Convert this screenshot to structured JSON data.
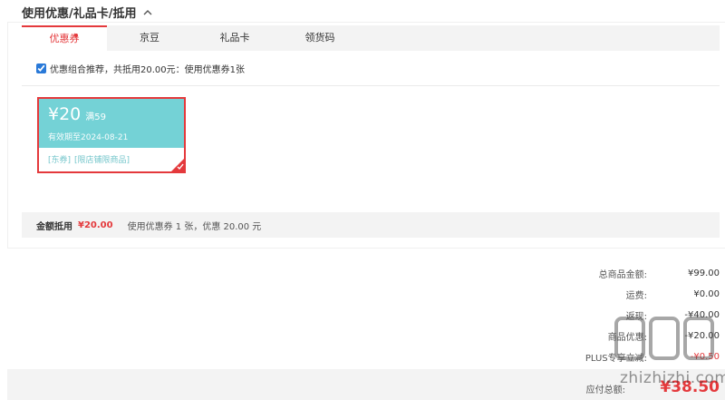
{
  "section": {
    "title": "使用优惠/礼品卡/抵用"
  },
  "tabs": [
    {
      "label": "优惠券"
    },
    {
      "label": "京豆"
    },
    {
      "label": "礼品卡"
    },
    {
      "label": "领货码"
    }
  ],
  "combo": {
    "label": "优惠组合推荐，共抵用20.00元：使用优惠券1张",
    "checked": true
  },
  "coupon": {
    "amount": "¥20",
    "condition": "满59",
    "validity": "有效期至2024-08-21",
    "tags": [
      "[东券]",
      "[限店铺限商品]"
    ]
  },
  "summary": {
    "label": "金额抵用",
    "value": "¥20.00",
    "desc": "使用优惠券 1 张，优惠 20.00 元"
  },
  "totals": [
    {
      "label": "总商品金额:",
      "value": "¥99.00"
    },
    {
      "label": "运费:",
      "value": "¥0.00"
    },
    {
      "label": "返现:",
      "value": "-¥40.00"
    },
    {
      "label": "商品优惠:",
      "value": "-¥20.00"
    },
    {
      "label": "PLUS专享立减:",
      "value": "-¥0.50"
    }
  ],
  "payable": {
    "label": "应付总额:",
    "value": "¥38.50"
  },
  "watermark": {
    "text": "zhizhizhi.com"
  },
  "colors": {
    "accent": "#e4393c",
    "coupon_bg": "#74d2d6",
    "bar_bg": "#f3f3f3"
  }
}
